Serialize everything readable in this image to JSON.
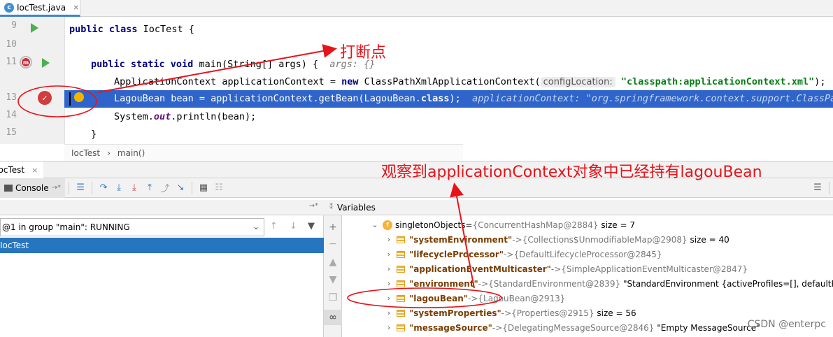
{
  "tab": {
    "label": "IocTest.java",
    "close": "×"
  },
  "gutter": {
    "line_numbers": [
      "9",
      "10",
      "11",
      "13",
      "14",
      "15"
    ],
    "method_marker": "m"
  },
  "code": {
    "l9": {
      "kw": "public class",
      "rest": " IocTest {"
    },
    "l11": {
      "kw1": "public static void",
      "rest": " main(String[] args) {",
      "hint": "args: {}"
    },
    "l12": {
      "a": "ApplicationContext applicationContext = ",
      "kw": "new",
      "b": " ClassPathXmlApplicationContext(",
      "param": "configLocation:",
      "str": "\"classpath:applicationContext.xml\"",
      "end": ");"
    },
    "l13": {
      "a": "LagouBean bean = applicationContext.getBean(LagouBean.",
      "kw": "class",
      "end": ");",
      "hint": "applicationContext: \"org.springframework.context.support.ClassPath"
    },
    "l14": {
      "a": "System.",
      "stat": "out",
      "b": ".println(bean);"
    },
    "l15": {
      "a": "}"
    }
  },
  "breadcrumb": {
    "class": "IocTest",
    "sep": "›",
    "method": "main()"
  },
  "debug": {
    "tab_label": "IocTest",
    "console_label": "Console",
    "thread": "@1 in group \"main\": RUNNING",
    "frame": "IocTest",
    "variables_label": "Variables"
  },
  "variables": {
    "root": {
      "name": "singletonObjects",
      "eq": " = ",
      "value": "{ConcurrentHashMap@2884}",
      "size": "size = 7",
      "badge": "f"
    },
    "items": [
      {
        "key": "\"systemEnvironment\"",
        "arrow": " -> ",
        "value": "{Collections$UnmodifiableMap@2908}",
        "extra": "size = 40"
      },
      {
        "key": "\"lifecycleProcessor\"",
        "arrow": " -> ",
        "value": "{DefaultLifecycleProcessor@2845}",
        "extra": ""
      },
      {
        "key": "\"applicationEventMulticaster\"",
        "arrow": " -> ",
        "value": "{SimpleApplicationEventMulticaster@2847}",
        "extra": ""
      },
      {
        "key": "\"environment\"",
        "arrow": " -> ",
        "value": "{StandardEnvironment@2839}",
        "extra": "\"StandardEnvironment {activeProfiles=[], defaultProfil"
      },
      {
        "key": "\"lagouBean\"",
        "arrow": " -> ",
        "value": "{LagouBean@2913}",
        "extra": ""
      },
      {
        "key": "\"systemProperties\"",
        "arrow": " -> ",
        "value": "{Properties@2915}",
        "extra": "size = 56"
      },
      {
        "key": "\"messageSource\"",
        "arrow": " -> ",
        "value": "{DelegatingMessageSource@2846}",
        "extra": "\"Empty MessageSource\""
      }
    ]
  },
  "annotations": {
    "breakpoint": "打断点",
    "observe": "观察到applicationContext对象中已经持有lagouBean"
  },
  "watermark": "CSDN @enterpc",
  "colors": {
    "annotation": "#e6141a",
    "selection": "#2f65ca"
  }
}
